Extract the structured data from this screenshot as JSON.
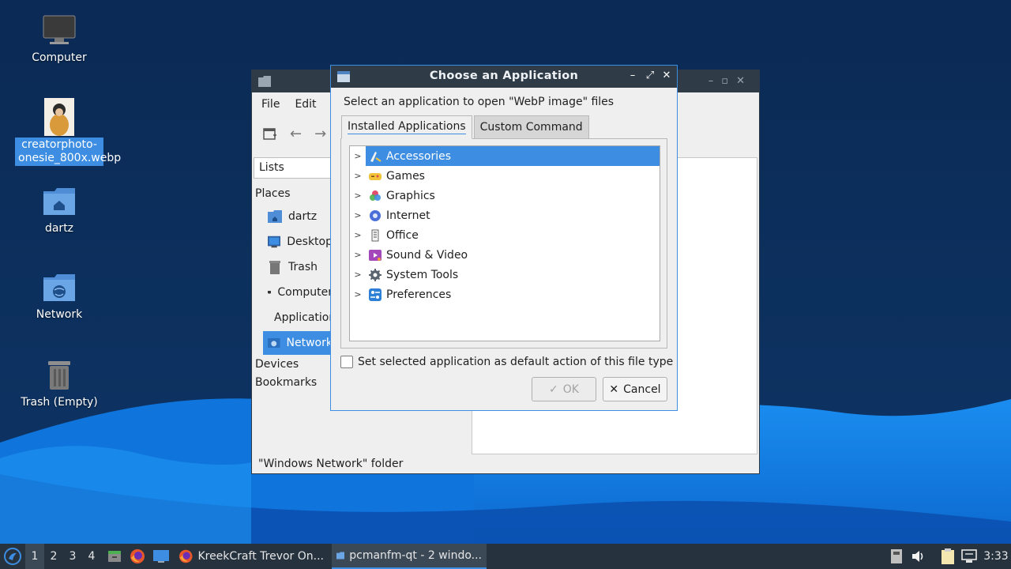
{
  "desktop": {
    "icons": [
      {
        "label": "Computer"
      },
      {
        "label": "creatorphoto-onesie_800x.webp"
      },
      {
        "label": "dartz"
      },
      {
        "label": "Network"
      },
      {
        "label": "Trash (Empty)"
      }
    ]
  },
  "file_manager": {
    "menu": {
      "file": "File",
      "edit": "Edit"
    },
    "side_view_select": "Lists",
    "places_header": "Places",
    "places": [
      {
        "label": "dartz",
        "icon": "home-folder-icon"
      },
      {
        "label": "Desktop",
        "icon": "desktop-icon"
      },
      {
        "label": "Trash",
        "icon": "trash-icon"
      },
      {
        "label": "Computer",
        "icon": "computer-icon"
      },
      {
        "label": "Applications",
        "icon": "applications-icon"
      },
      {
        "label": "Network",
        "icon": "network-icon"
      }
    ],
    "devices_header": "Devices",
    "bookmarks_header": "Bookmarks",
    "status_text": "\"Windows Network\" folder"
  },
  "dialog": {
    "title": "Choose an Application",
    "prompt": "Select an application to open \"WebP image\" files",
    "tabs": [
      {
        "label": "Installed Applications"
      },
      {
        "label": "Custom Command"
      }
    ],
    "categories": [
      {
        "label": "Accessories",
        "icon": "accessories-icon",
        "color": "#3d8ee2"
      },
      {
        "label": "Games",
        "icon": "games-icon",
        "color": "#f2c23a"
      },
      {
        "label": "Graphics",
        "icon": "graphics-icon",
        "color": "#e04e6e"
      },
      {
        "label": "Internet",
        "icon": "internet-icon",
        "color": "#4a6fd8"
      },
      {
        "label": "Office",
        "icon": "office-icon",
        "color": "#555555"
      },
      {
        "label": "Sound & Video",
        "icon": "sound-video-icon",
        "color": "#a347ba"
      },
      {
        "label": "System Tools",
        "icon": "system-tools-icon",
        "color": "#5a6470"
      },
      {
        "label": "Preferences",
        "icon": "preferences-icon",
        "color": "#2e7fd6"
      }
    ],
    "default_checkbox_label": "Set selected application as default action of this file type",
    "ok_label": "OK",
    "cancel_label": "Cancel"
  },
  "taskbar": {
    "workspaces": [
      "1",
      "2",
      "3",
      "4"
    ],
    "tasks": [
      {
        "label": "KreekCraft Trevor On..."
      },
      {
        "label": "pcmanfm-qt - 2 windo..."
      }
    ],
    "clock": "3:33"
  },
  "colors": {
    "accent": "#3d8ee2",
    "titlebar": "#2f3c48",
    "taskbar": "#26323e"
  }
}
